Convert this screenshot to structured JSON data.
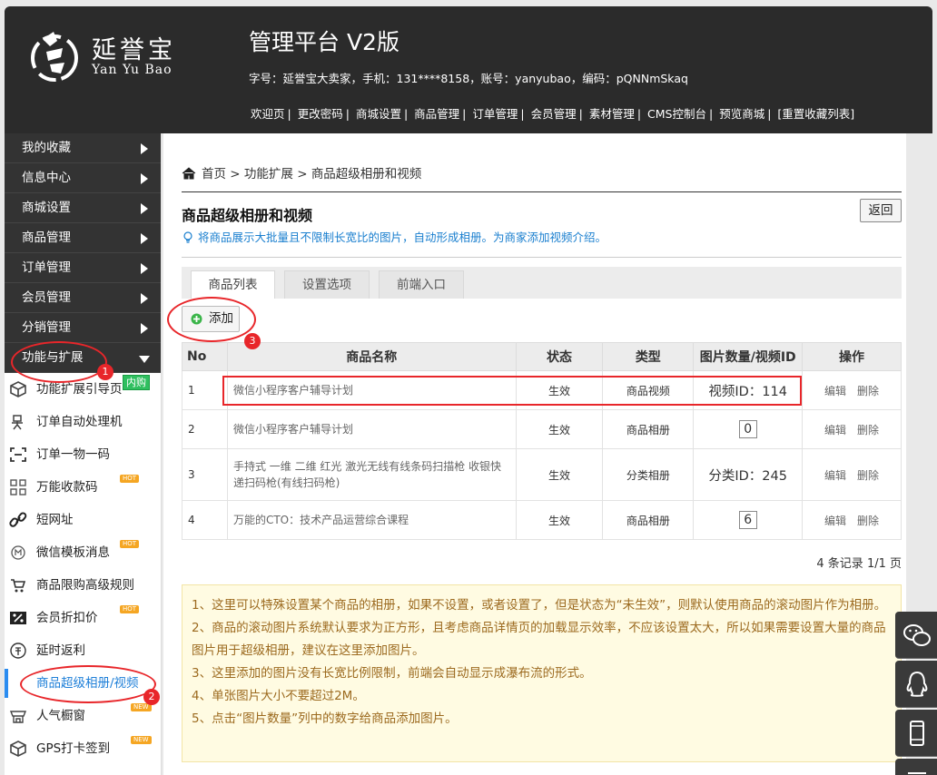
{
  "header": {
    "logo_cn": "延誉宝",
    "logo_en": "Yan Yu Bao",
    "platform_title": "管理平台 V2版",
    "account_info": "字号：延誉宝大卖家，手机：131****8158，账号：yanyubao，编码：pQNNmSkaq",
    "nav": [
      "欢迎页",
      "更改密码",
      "商城设置",
      "商品管理",
      "订单管理",
      "会员管理",
      "素材管理",
      "CMS控制台",
      "预览商城",
      "[重置收藏列表]"
    ]
  },
  "sidebar": {
    "groups": [
      "我的收藏",
      "信息中心",
      "商城设置",
      "商品管理",
      "订单管理",
      "会员管理",
      "分销管理",
      "功能与扩展"
    ],
    "items": [
      {
        "label": "功能扩展引导页",
        "icon": "cube-icon",
        "badge": "内购"
      },
      {
        "label": "订单自动处理机",
        "icon": "robot-icon",
        "badge": ""
      },
      {
        "label": "订单一物一码",
        "icon": "scan-code-icon",
        "badge": ""
      },
      {
        "label": "万能收款码",
        "icon": "qr-code-icon",
        "badge": "HOT"
      },
      {
        "label": "短网址",
        "icon": "link-icon",
        "badge": ""
      },
      {
        "label": "微信模板消息",
        "icon": "template-icon",
        "badge": "HOT"
      },
      {
        "label": "商品限购高级规则",
        "icon": "cart-icon",
        "badge": ""
      },
      {
        "label": "会员折扣价",
        "icon": "percent-icon",
        "badge": "HOT"
      },
      {
        "label": "延时返利",
        "icon": "rebate-icon",
        "badge": ""
      },
      {
        "label": "商品超级相册/视频",
        "icon": "",
        "badge": ""
      },
      {
        "label": "人气橱窗",
        "icon": "showcase-icon",
        "badge": "NEW"
      },
      {
        "label": "GPS打卡签到",
        "icon": "cube-icon",
        "badge": "NEW"
      }
    ],
    "badge_hot": "HOT",
    "badge_new": "NEW"
  },
  "main": {
    "breadcrumb": [
      "首页",
      "功能扩展",
      "商品超级相册和视频"
    ],
    "title": "商品超级相册和视频",
    "tip": "将商品展示大批量且不限制长宽比的图片，自动形成相册。为商家添加视频介绍。",
    "back_label": "返回",
    "tabs": [
      "商品列表",
      "设置选项",
      "前端入口"
    ],
    "add_label": "添加",
    "table": {
      "headers": [
        "No",
        "商品名称",
        "状态",
        "类型",
        "图片数量/视频ID",
        "操作"
      ],
      "rows": [
        {
          "no": "1",
          "name": "微信小程序客户辅导计划",
          "status": "生效",
          "type": "商品视频",
          "media": "视频ID：114",
          "media_kind": "text"
        },
        {
          "no": "2",
          "name": "微信小程序客户辅导计划",
          "status": "生效",
          "type": "商品相册",
          "media": "0",
          "media_kind": "box"
        },
        {
          "no": "3",
          "name": "手持式 一维 二维 红光 激光无线有线条码扫描枪 收银快递扫码枪(有线扫码枪)",
          "status": "生效",
          "type": "分类相册",
          "media": "分类ID：245",
          "media_kind": "text"
        },
        {
          "no": "4",
          "name": "万能的CTO：技术产品运营综合课程",
          "status": "生效",
          "type": "商品相册",
          "media": "6",
          "media_kind": "box"
        }
      ],
      "edit_label": "编辑",
      "delete_label": "删除"
    },
    "pager": "4 条记录 1/1 页",
    "notes": [
      "1、这里可以特殊设置某个商品的相册，如果不设置，或者设置了，但是状态为“未生效”，则默认使用商品的滚动图片作为相册。",
      "2、商品的滚动图片系统默认要求为正方形，且考虑商品详情页的加载显示效率，不应该设置太大，所以如果需要设置大量的商品图片用于超级相册，建议在这里添加图片。",
      "3、这里添加的图片没有长宽比例限制，前端会自动显示成瀑布流的形式。",
      "4、单张图片大小不要超过2M。",
      "5、点击“图片数量”列中的数字给商品添加图片。"
    ]
  },
  "annotations": [
    "1",
    "2",
    "3"
  ],
  "colors": {
    "header_bg": "#2b2b2b",
    "accent_blue": "#1e7fd8",
    "annotation_red": "#e8262a",
    "note_bg": "#fffbe2",
    "note_text": "#9c6a1f"
  }
}
